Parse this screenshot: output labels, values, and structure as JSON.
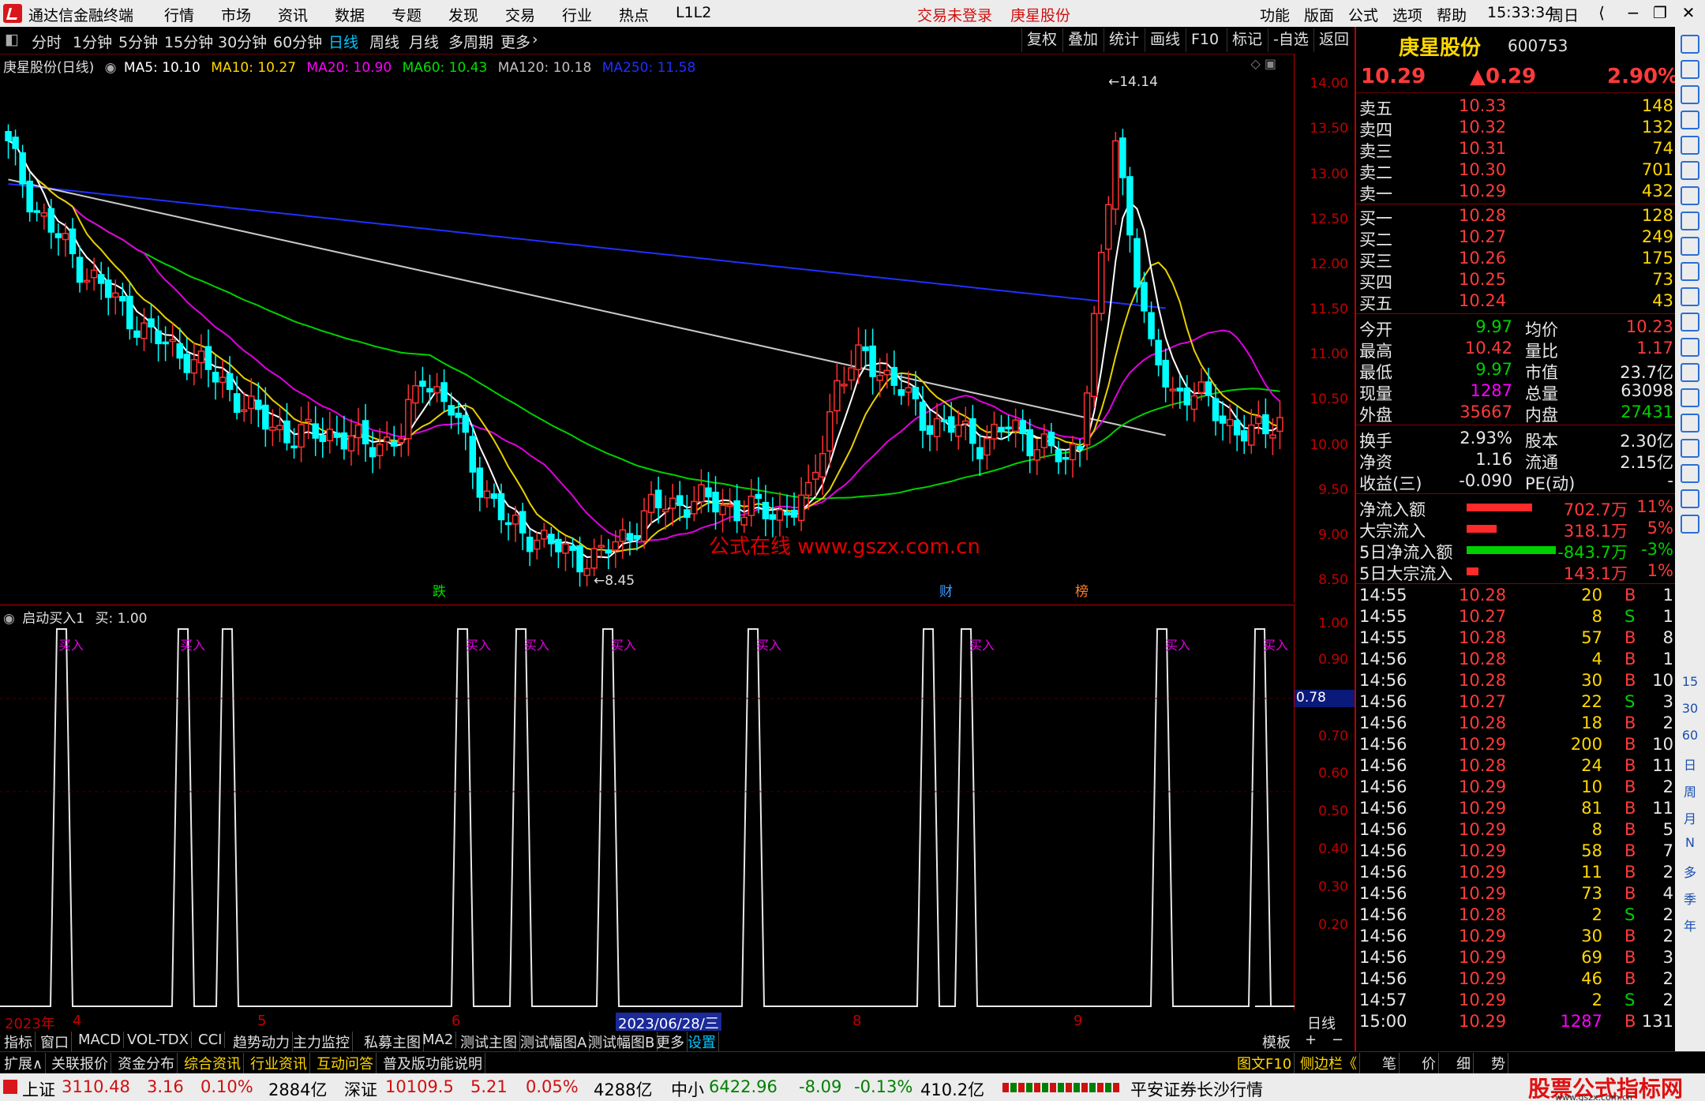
{
  "menubar": {
    "app_title": "通达信金融终端",
    "menus": [
      "行情",
      "市场",
      "资讯",
      "数据",
      "专题",
      "发现",
      "交易",
      "行业",
      "热点",
      "L1L2"
    ],
    "trade_status": "交易未登录",
    "stock_name": "庚星股份",
    "right_menus": [
      "功能",
      "版面",
      "公式",
      "选项",
      "帮助"
    ],
    "clock": "15:33:34",
    "weekday": "周日"
  },
  "periodbar": {
    "periods": [
      "分时",
      "1分钟",
      "5分钟",
      "15分钟",
      "30分钟",
      "60分钟",
      "日线",
      "周线",
      "月线",
      "多周期",
      "更多"
    ],
    "active": "日线",
    "right_buttons": [
      "复权",
      "叠加",
      "统计",
      "画线",
      "F10",
      "标记",
      "-自选",
      "返回"
    ]
  },
  "mainchart": {
    "label": "庚星股份(日线)",
    "ma": [
      {
        "name": "MA5",
        "value": "10.10",
        "color": "#ffffff"
      },
      {
        "name": "MA10",
        "value": "10.27",
        "color": "#ffd800"
      },
      {
        "name": "MA20",
        "value": "10.90",
        "color": "#ff00ff"
      },
      {
        "name": "MA60",
        "value": "10.43",
        "color": "#00e000"
      },
      {
        "name": "MA120",
        "value": "10.18",
        "color": "#c0c0c0"
      },
      {
        "name": "MA250",
        "value": "11.58",
        "color": "#2030ff"
      }
    ],
    "high_mark": "14.14",
    "low_mark": "8.45",
    "watermark": "公式在线  www.gszx.com.cn",
    "event_marks": [
      {
        "label": "跌",
        "color": "#00e000"
      },
      {
        "label": "财",
        "color": "#3aa0ff"
      },
      {
        "label": "榜",
        "color": "#ff8030"
      }
    ]
  },
  "chart_data": {
    "type": "candlestick",
    "title": "庚星股份(日线)",
    "ylim": [
      8.3,
      14.3
    ],
    "yticks": [
      "14.00",
      "13.50",
      "13.00",
      "12.50",
      "12.00",
      "11.50",
      "11.00",
      "10.50",
      "10.00",
      "9.50",
      "9.00",
      "8.50"
    ],
    "x_labels": [
      "2023年",
      "4",
      "5",
      "6",
      "2023/06/28/三",
      "8",
      "9",
      "日线"
    ],
    "indicator": {
      "name": "启动买入1",
      "buy_value": "1.00",
      "yticks": [
        "1.00",
        "0.90",
        "0.70",
        "0.60",
        "0.50",
        "0.40",
        "0.30",
        "0.20"
      ],
      "cursor_value": "0.78",
      "signal_label": "买入",
      "signal_count": 11
    }
  },
  "quote": {
    "name": "庚星股份",
    "code": "600753",
    "price": "10.29",
    "change": "▲0.29",
    "change_pct": "2.90%",
    "asks": [
      {
        "label": "卖五",
        "price": "10.33",
        "vol": "148"
      },
      {
        "label": "卖四",
        "price": "10.32",
        "vol": "132"
      },
      {
        "label": "卖三",
        "price": "10.31",
        "vol": "74"
      },
      {
        "label": "卖二",
        "price": "10.30",
        "vol": "701"
      },
      {
        "label": "卖一",
        "price": "10.29",
        "vol": "432"
      }
    ],
    "bids": [
      {
        "label": "买一",
        "price": "10.28",
        "vol": "128"
      },
      {
        "label": "买二",
        "price": "10.27",
        "vol": "249"
      },
      {
        "label": "买三",
        "price": "10.26",
        "vol": "175"
      },
      {
        "label": "买四",
        "price": "10.25",
        "vol": "73"
      },
      {
        "label": "买五",
        "price": "10.24",
        "vol": "43"
      }
    ],
    "stats1": [
      {
        "l1": "今开",
        "v1": "9.97",
        "c1": "grn",
        "l2": "均价",
        "v2": "10.23",
        "c2": "red"
      },
      {
        "l1": "最高",
        "v1": "10.42",
        "c1": "red",
        "l2": "量比",
        "v2": "1.17",
        "c2": "red"
      },
      {
        "l1": "最低",
        "v1": "9.97",
        "c1": "grn",
        "l2": "市值",
        "v2": "23.7亿",
        "c2": "white"
      },
      {
        "l1": "现量",
        "v1": "1287",
        "c1": "mag",
        "l2": "总量",
        "v2": "63098",
        "c2": "white"
      },
      {
        "l1": "外盘",
        "v1": "35667",
        "c1": "red",
        "l2": "内盘",
        "v2": "27431",
        "c2": "grn"
      }
    ],
    "stats2": [
      {
        "l1": "换手",
        "v1": "2.93%",
        "l2": "股本",
        "v2": "2.30亿"
      },
      {
        "l1": "净资",
        "v1": "1.16",
        "l2": "流通",
        "v2": "2.15亿"
      },
      {
        "l1": "收益(三)",
        "v1": "-0.090",
        "l2": "PE(动)",
        "v2": "-"
      }
    ],
    "flows": [
      {
        "label": "净流入额",
        "value": "702.7万",
        "pct": "11%",
        "color": "red",
        "bar": 0.55
      },
      {
        "label": "大宗流入",
        "value": "318.1万",
        "pct": "5%",
        "color": "red",
        "bar": 0.25
      },
      {
        "label": "5日净流入额",
        "value": "-843.7万",
        "pct": "-3%",
        "color": "grn",
        "bar": 0.75
      },
      {
        "label": "5日大宗流入",
        "value": "143.1万",
        "pct": "1%",
        "color": "red",
        "bar": 0.1
      }
    ],
    "ticks": [
      {
        "t": "14:55",
        "p": "10.28",
        "v": "20",
        "s": "B",
        "n": "1"
      },
      {
        "t": "14:55",
        "p": "10.27",
        "v": "8",
        "s": "S",
        "n": "1"
      },
      {
        "t": "14:55",
        "p": "10.28",
        "v": "57",
        "s": "B",
        "n": "8"
      },
      {
        "t": "14:56",
        "p": "10.28",
        "v": "4",
        "s": "B",
        "n": "1"
      },
      {
        "t": "14:56",
        "p": "10.28",
        "v": "30",
        "s": "B",
        "n": "10"
      },
      {
        "t": "14:56",
        "p": "10.27",
        "v": "22",
        "s": "S",
        "n": "3"
      },
      {
        "t": "14:56",
        "p": "10.28",
        "v": "18",
        "s": "B",
        "n": "2"
      },
      {
        "t": "14:56",
        "p": "10.29",
        "v": "200",
        "s": "B",
        "n": "10"
      },
      {
        "t": "14:56",
        "p": "10.28",
        "v": "24",
        "s": "B",
        "n": "11"
      },
      {
        "t": "14:56",
        "p": "10.29",
        "v": "10",
        "s": "B",
        "n": "2"
      },
      {
        "t": "14:56",
        "p": "10.29",
        "v": "81",
        "s": "B",
        "n": "11"
      },
      {
        "t": "14:56",
        "p": "10.29",
        "v": "8",
        "s": "B",
        "n": "5"
      },
      {
        "t": "14:56",
        "p": "10.29",
        "v": "58",
        "s": "B",
        "n": "7"
      },
      {
        "t": "14:56",
        "p": "10.29",
        "v": "11",
        "s": "B",
        "n": "2"
      },
      {
        "t": "14:56",
        "p": "10.29",
        "v": "73",
        "s": "B",
        "n": "4"
      },
      {
        "t": "14:56",
        "p": "10.28",
        "v": "2",
        "s": "S",
        "n": "2"
      },
      {
        "t": "14:56",
        "p": "10.29",
        "v": "30",
        "s": "B",
        "n": "2"
      },
      {
        "t": "14:56",
        "p": "10.29",
        "v": "69",
        "s": "B",
        "n": "3"
      },
      {
        "t": "14:56",
        "p": "10.29",
        "v": "46",
        "s": "B",
        "n": "2"
      },
      {
        "t": "14:57",
        "p": "10.29",
        "v": "2",
        "s": "S",
        "n": "2"
      },
      {
        "t": "15:00",
        "p": "10.29",
        "v": "1287",
        "s": "B",
        "n": "131"
      }
    ],
    "bottom_tabs": [
      "笔",
      "价",
      "细",
      "势"
    ]
  },
  "tabs1": [
    "指标",
    "窗口",
    "MACD",
    "VOL-TDX",
    "CCI",
    "趋势动力",
    "主力监控",
    "私募主图",
    "MA2",
    "测试主图",
    "测试幅图A",
    "测试幅图B",
    "更多",
    "设置"
  ],
  "tabs1_right": [
    "模板",
    "+",
    "−"
  ],
  "tabs2": [
    "扩展∧",
    "关联报价",
    "资金分布",
    "综合资讯",
    "行业资讯",
    "互动问答",
    "普及版功能说明"
  ],
  "tabs2_right": [
    "图文F10",
    "侧边栏《"
  ],
  "statusbar": {
    "sh_label": "上证",
    "sh_val": "3110.48",
    "sh_chg": "3.16",
    "sh_pct": "0.10%",
    "sh_amt": "2884亿",
    "sz_label": "深证",
    "sz_val": "10109.5",
    "sz_chg": "5.21",
    "sz_pct": "0.05%",
    "sz_amt": "4288亿",
    "zx_label": "中小",
    "zx_val": "6422.96",
    "zx_chg": "-8.09",
    "zx_pct": "-0.13%",
    "zx_amt": "410.2亿",
    "broker": "平安证券长沙行情",
    "brand": "股票公式指标网",
    "brand_url": "www.gszx.com.cn"
  },
  "sidetools": [
    "15",
    "30",
    "60",
    "日",
    "周",
    "月",
    "N",
    "多",
    "季",
    "年"
  ]
}
